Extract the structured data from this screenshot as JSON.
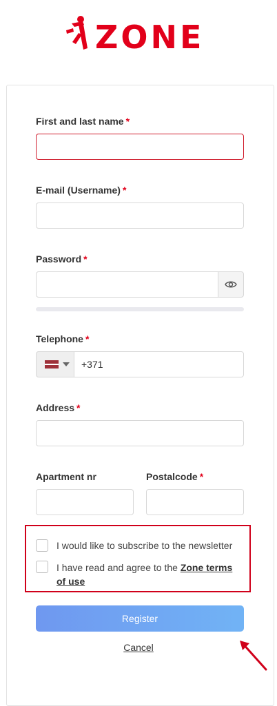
{
  "brand": {
    "name": "ZONE",
    "color": "#e2001a",
    "logo_icon": "running-person-icon"
  },
  "form": {
    "name": {
      "label": "First and last name",
      "required_mark": "*",
      "value": ""
    },
    "email": {
      "label": "E-mail (Username)",
      "required_mark": "*",
      "value": ""
    },
    "password": {
      "label": "Password",
      "required_mark": "*",
      "value": "",
      "toggle_icon": "eye-icon"
    },
    "telephone": {
      "label": "Telephone",
      "required_mark": "*",
      "country_flag": "latvia-flag-icon",
      "value": "+371"
    },
    "address": {
      "label": "Address",
      "required_mark": "*",
      "value": ""
    },
    "apartment": {
      "label": "Apartment nr",
      "value": ""
    },
    "postalcode": {
      "label": "Postalcode",
      "required_mark": "*",
      "value": ""
    },
    "newsletter": {
      "label": "I would like to subscribe to the newsletter",
      "checked": false
    },
    "terms": {
      "label_prefix": "I have read and agree to the",
      "link_text": "Zone terms of use",
      "checked": false
    },
    "register_label": "Register",
    "cancel_label": "Cancel"
  },
  "colors": {
    "error": "#cf1b2b",
    "highlight": "#d0001a",
    "button_start": "#6f98f0",
    "button_end": "#71b3f5"
  }
}
